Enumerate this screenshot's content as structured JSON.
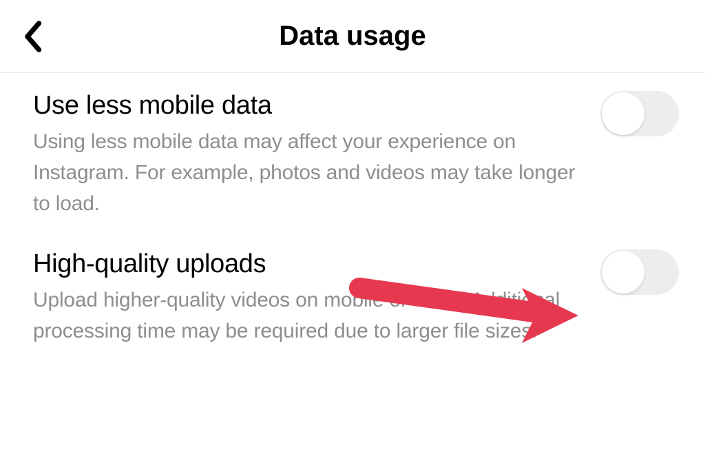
{
  "header": {
    "title": "Data usage"
  },
  "settings": [
    {
      "title": "Use less mobile data",
      "desc": "Using less mobile data may affect your experience on Instagram. For example, photos and videos may take longer to load.",
      "on": false
    },
    {
      "title": "High-quality uploads",
      "desc": "Upload higher-quality videos on mobile or Wi-Fi. Additional processing time may be required due to larger file sizes.",
      "on": false
    }
  ],
  "annotation": {
    "arrow_color": "#e63950"
  }
}
